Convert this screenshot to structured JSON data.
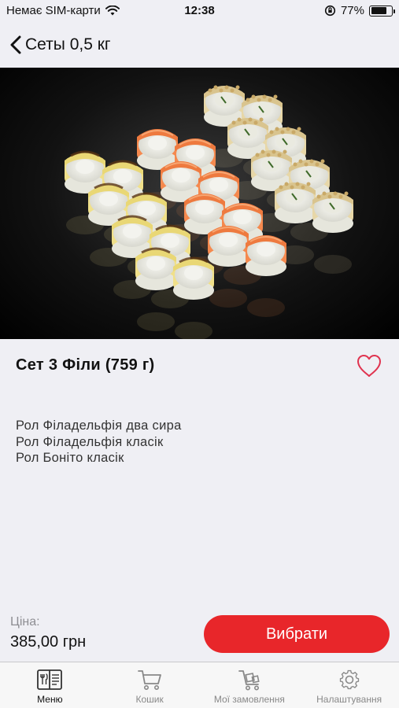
{
  "status_bar": {
    "carrier": "Немає SIM-карти",
    "time": "12:38",
    "battery": "77%",
    "battery_level": 0.77
  },
  "nav": {
    "back_label": "Сеты 0,5 кг"
  },
  "product": {
    "title": "Сет 3 Філи (759 г)",
    "ingredients": [
      "Рол Філадельфія два сира",
      "Рол Філадельфія класік",
      "Рол Боніто класік"
    ],
    "price_label": "Ціна:",
    "price": "385,00 грн",
    "select_label": "Вибрати"
  },
  "tabs": [
    {
      "label": "Меню",
      "icon": "menu-book-icon",
      "active": true
    },
    {
      "label": "Кошик",
      "icon": "cart-icon",
      "active": false
    },
    {
      "label": "Мої замовлення",
      "icon": "orders-cart-icon",
      "active": false
    },
    {
      "label": "Налаштування",
      "icon": "settings-gear-icon",
      "active": false
    }
  ],
  "colors": {
    "accent": "#e8262a",
    "background": "#efeff4",
    "favorite": "#e0334f"
  }
}
